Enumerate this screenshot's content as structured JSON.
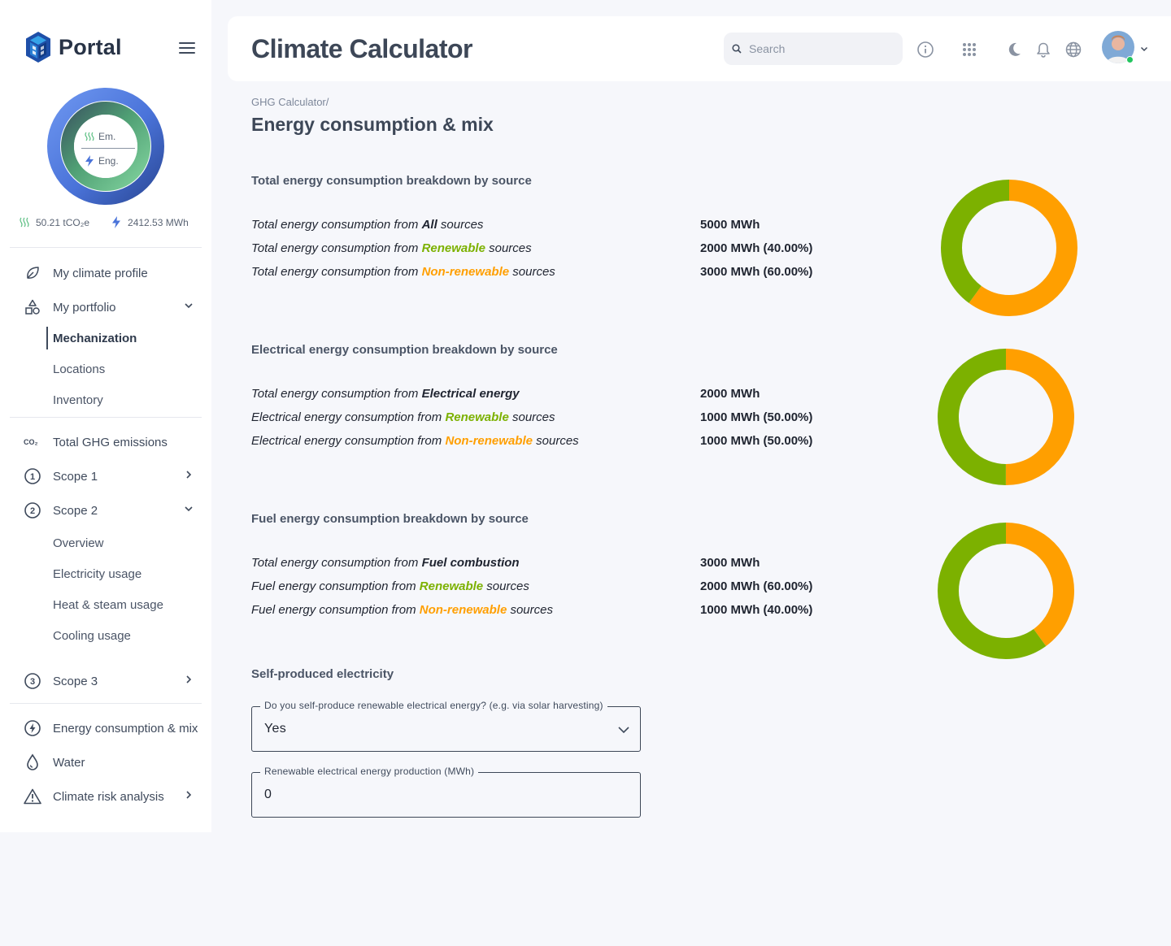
{
  "app": {
    "logo_text": "Portal",
    "page_title": "Climate Calculator"
  },
  "sidebar": {
    "ring": {
      "emissions_label": "Em.",
      "energy_label": "Eng."
    },
    "stats": {
      "emissions": "50.21 tCO₂e",
      "energy": "2412.53 MWh"
    },
    "nav": {
      "climate_profile": "My climate profile",
      "portfolio": "My portfolio",
      "portfolio_children": [
        "Mechanization",
        "Locations",
        "Inventory"
      ],
      "total_ghg": "Total GHG emissions",
      "scope1": "Scope 1",
      "scope2": "Scope 2",
      "scope2_children": [
        "Overview",
        "Electricity usage",
        "Heat & steam usage",
        "Cooling usage"
      ],
      "scope3": "Scope 3",
      "energy": "Energy consumption & mix",
      "water": "Water",
      "climate_risk": "Climate risk analysis"
    },
    "active_item": "Mechanization"
  },
  "header": {
    "search_placeholder": "Search",
    "icons": [
      "info-icon",
      "apps-grid-icon",
      "moon-icon",
      "bell-icon",
      "globe-icon"
    ]
  },
  "breadcrumb": "GHG Calculator/",
  "heading": "Energy consumption & mix",
  "colors": {
    "renewable": "#7cb100",
    "non_renewable": "#ff9f00",
    "ring_outer": "#4a73d9",
    "ring_inner": "#6fc08c"
  },
  "sections": [
    {
      "title": "Total energy consumption breakdown by source",
      "rows": [
        {
          "pre": "Total energy consumption from ",
          "key": "All",
          "post": " sources",
          "value": "5000 MWh"
        },
        {
          "pre": "Total energy consumption from ",
          "key": "Renewable",
          "post": " sources",
          "value": "2000 MWh (40.00%)"
        },
        {
          "pre": "Total energy consumption from ",
          "key": "Non-renewable",
          "post": " sources",
          "value": "3000 MWh (60.00%)"
        }
      ],
      "donut": {
        "renewable": 40,
        "non_renewable": 60
      }
    },
    {
      "title": "Electrical energy consumption breakdown by source",
      "rows": [
        {
          "pre": "Total energy consumption from ",
          "key": "Electrical energy",
          "post": "",
          "value": "2000 MWh"
        },
        {
          "pre": "Electrical energy consumption from ",
          "key": "Renewable",
          "post": " sources",
          "value": "1000 MWh (50.00%)"
        },
        {
          "pre": "Electrical energy consumption from ",
          "key": "Non-renewable",
          "post": " sources",
          "value": "1000 MWh (50.00%)"
        }
      ],
      "donut": {
        "renewable": 50,
        "non_renewable": 50
      }
    },
    {
      "title": "Fuel energy consumption breakdown by source",
      "rows": [
        {
          "pre": "Total energy consumption from ",
          "key": "Fuel combustion",
          "post": "",
          "value": "3000 MWh"
        },
        {
          "pre": "Fuel energy consumption from ",
          "key": "Renewable",
          "post": " sources",
          "value": "2000 MWh (60.00%)"
        },
        {
          "pre": "Fuel energy consumption from ",
          "key": "Non-renewable",
          "post": " sources",
          "value": "1000 MWh (40.00%)"
        }
      ],
      "donut": {
        "renewable": 60,
        "non_renewable": 40
      }
    }
  ],
  "self_produced": {
    "title": "Self-produced electricity",
    "question_label": "Do you self-produce renewable electrical energy? (e.g. via solar harvesting)",
    "question_value": "Yes",
    "production_label": "Renewable electrical energy production (MWh)",
    "production_value": "0"
  }
}
